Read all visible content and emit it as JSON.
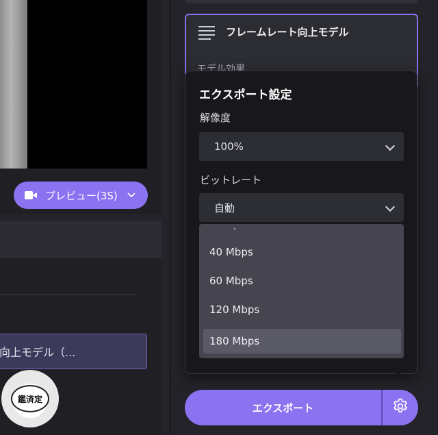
{
  "left_panel": {
    "preview_button": {
      "label": "プレビュー(3S)"
    },
    "model_chip": {
      "label": "向上モデル（..."
    },
    "watermark": {
      "text": "鑑済定"
    }
  },
  "right_panel": {
    "frame_model_card": {
      "title": "フレームレート向上モデル",
      "effect_label": "モデル効果"
    },
    "export_settings": {
      "title": "エクスポート設定",
      "resolution_label": "解像度",
      "resolution_value": "100%",
      "bitrate_label": "ビットレート",
      "bitrate_value": "自動",
      "bitrate_options": [
        "40 Mbps",
        "60 Mbps",
        "120 Mbps",
        "180 Mbps"
      ],
      "highlighted_option": "180 Mbps"
    },
    "export_button": {
      "label": "エクスポート"
    }
  },
  "colors": {
    "accent": "#8b72f0",
    "background": "#232329",
    "popup": "#18181c",
    "dropdown_list": "#46454f"
  },
  "icons": [
    "video-camera-icon",
    "chevron-down-icon",
    "frame-model-icon",
    "gear-icon"
  ]
}
